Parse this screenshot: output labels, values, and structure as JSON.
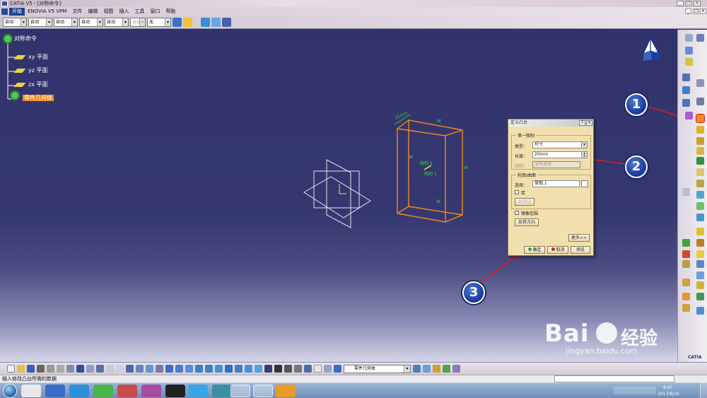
{
  "window": {
    "title": "CATIA V5 - [对称命令]"
  },
  "menubar": {
    "items": [
      "开始",
      "ENOVIA V5 VPM",
      "文件",
      "编辑",
      "视图",
      "插入",
      "工具",
      "窗口",
      "帮助"
    ]
  },
  "graphics_toolbar": {
    "combos": [
      "自动",
      "自动",
      "自动",
      "自动",
      "自动",
      "自动",
      "无"
    ]
  },
  "spec_tree": {
    "root": "对称命令",
    "planes": [
      "xy 平面",
      "yz 平面",
      "zx 平面"
    ],
    "body": "零件几何体"
  },
  "model_labels": {
    "dimension": "20mm",
    "limit2": "限制 2",
    "limit1": "限制 1",
    "handle": "W"
  },
  "dialog": {
    "title": "定义凸台",
    "first_limit_group": "第一限制",
    "type_label": "类型：",
    "type_value": "尺寸",
    "length_label": "长度：",
    "length_value": "20mm",
    "limit_label": "限制：",
    "limit_value": "没有选择",
    "profile_group": "轮廓/曲面",
    "selection_label": "选择：",
    "selection_value": "草图.1",
    "thick_label": "厚",
    "reverse_side_label": "反转边",
    "mirror_label": "镜像范围",
    "reverse_direction_label": "反转方向",
    "more_label": "更多>>",
    "ok_label": "确定",
    "cancel_label": "取消",
    "preview_label": "预览"
  },
  "callouts": [
    "1",
    "2",
    "3"
  ],
  "bottom_toolbar": {
    "current_body": "零件几何体"
  },
  "status": {
    "message": "输入修改凸台所需的数据"
  },
  "taskbar": {
    "time": "9:47",
    "date": "2017/8/26"
  },
  "watermark": {
    "brand": "Bai",
    "brand2": "经验",
    "url": "jingyan.baidu.com"
  },
  "right_logo": "CATIA"
}
